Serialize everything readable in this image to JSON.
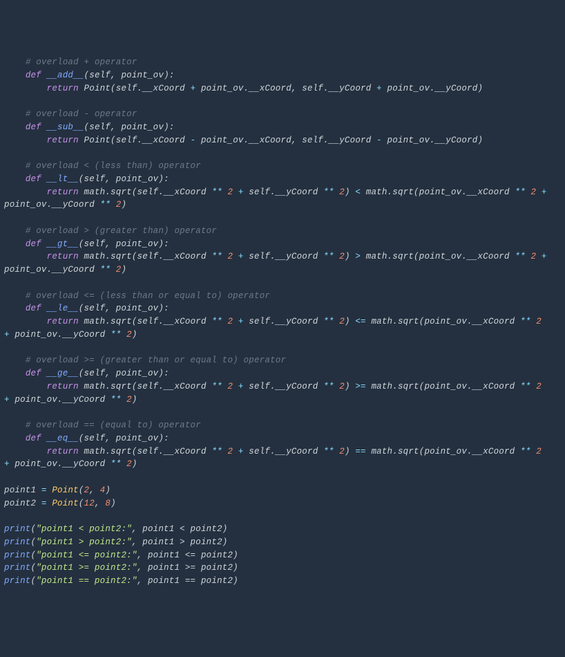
{
  "code": {
    "add": {
      "comment": "# overload + operator",
      "def": "def",
      "name": "__add__",
      "params": "(self, point_ov):",
      "ret": "return",
      "body_prefix": " Point(self.__xCoord ",
      "op1": "+",
      "body_mid1": " point_ov.__xCoord, self.__yCoord ",
      "op2": "+",
      "body_suffix": " point_ov.__yCoord)"
    },
    "sub": {
      "comment": "# overload - operator",
      "name": "__sub__",
      "params": "(self, point_ov):",
      "body_prefix": " Point(self.__xCoord ",
      "op1": "-",
      "body_mid1": " point_ov.__xCoord, self.__yCoord ",
      "op2": "-",
      "body_suffix": " point_ov.__yCoord)"
    },
    "lt": {
      "comment": "# overload < (less than) operator",
      "name": "__lt__",
      "params": "(self, point_ov):",
      "body1": " math.sqrt(self.__xCoord ",
      "pow": "**",
      "two": "2",
      "plus": "+",
      "body2": " self.__yCoord ",
      "cmp": "<",
      "body3": " math.sqrt(point_ov.__xCoord ",
      "body4": "point_ov.__yCoord ",
      "close": ")"
    },
    "gt": {
      "comment": "# overload > (greater than) operator",
      "name": "__gt__",
      "cmp": ">"
    },
    "le": {
      "comment": "# overload <= (less than or equal to) operator",
      "name": "__le__",
      "cmp": "<="
    },
    "ge": {
      "comment": "# overload >= (greater than or equal to) operator",
      "name": "__ge__",
      "cmp": ">="
    },
    "eq": {
      "comment": "# overload == (equal to) operator",
      "name": "__eq__",
      "cmp": "=="
    },
    "inst": {
      "p1": "point1 ",
      "p2": "point2 ",
      "assign": "=",
      "cls": " Point",
      "p1args_a": "2",
      "p1args_b": "4",
      "p2args_a": "12",
      "p2args_b": "8"
    },
    "prints": {
      "print": "print",
      "lt_str": "\"point1 < point2:\"",
      "lt_expr": ", point1 < point2)",
      "gt_str": "\"point1 > point2:\"",
      "gt_expr": ", point1 > point2)",
      "le_str": "\"point1 <= point2:\"",
      "le_expr": ", point1 <= point2)",
      "ge_str": "\"point1 >= point2:\"",
      "ge_expr": ", point1 >= point2)",
      "eq_str": "\"point1 == point2:\"",
      "eq_expr": ", point1 == point2)"
    }
  }
}
